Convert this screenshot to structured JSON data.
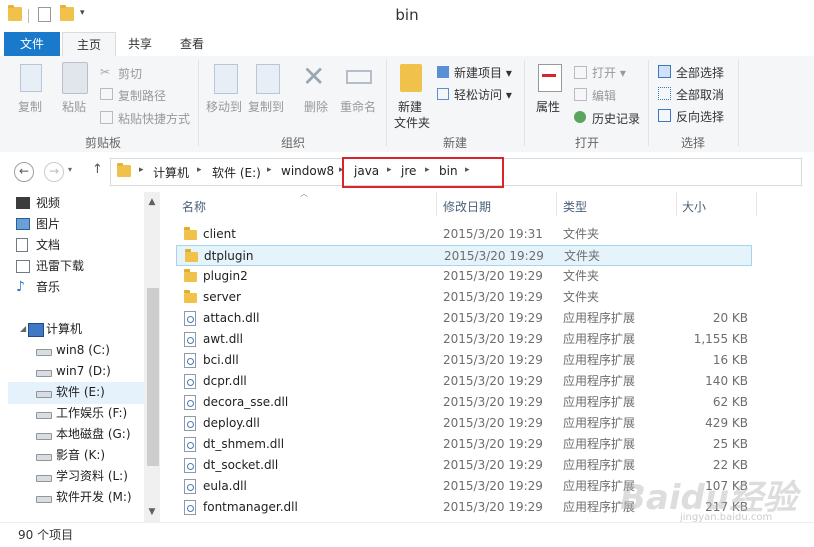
{
  "window": {
    "title": "bin"
  },
  "ribbon_tabs": [
    "文件",
    "主页",
    "共享",
    "查看"
  ],
  "ribbon": {
    "clipboard": {
      "group": "剪贴板",
      "copy": "复制",
      "paste": "粘贴",
      "cut": "剪切",
      "copy_path": "复制路径",
      "paste_shortcut": "粘贴快捷方式"
    },
    "organize": {
      "group": "组织",
      "move_to": "移动到",
      "copy_to": "复制到",
      "delete": "删除",
      "rename": "重命名"
    },
    "new": {
      "group": "新建",
      "new_folder_line1": "新建",
      "new_folder_line2": "文件夹",
      "new_item": "新建项目 ▾",
      "easy_access": "轻松访问 ▾"
    },
    "open": {
      "group": "打开",
      "properties": "属性",
      "open": "打开 ▾",
      "edit": "编辑",
      "history": "历史记录"
    },
    "select": {
      "group": "选择",
      "select_all": "全部选择",
      "select_none": "全部取消",
      "invert": "反向选择"
    }
  },
  "nav": {
    "back": "←",
    "forward": "→",
    "up": "↑"
  },
  "breadcrumb": [
    "计算机",
    "软件 (E:)",
    "window8",
    "java",
    "jre",
    "bin"
  ],
  "navpane": {
    "libraries": [
      "视频",
      "图片",
      "文档",
      "迅雷下载",
      "音乐"
    ],
    "computer": "计算机",
    "drives": [
      "win8 (C:)",
      "win7 (D:)",
      "软件 (E:)",
      "工作娱乐 (F:)",
      "本地磁盘 (G:)",
      "影音 (K:)",
      "学习资料 (L:)",
      "软件开发 (M:)"
    ],
    "selected": "软件 (E:)"
  },
  "columns": {
    "name": "名称",
    "date": "修改日期",
    "type": "类型",
    "size": "大小"
  },
  "files": [
    {
      "name": "client",
      "date": "2015/3/20 19:31",
      "type": "文件夹",
      "size": "",
      "kind": "folder"
    },
    {
      "name": "dtplugin",
      "date": "2015/3/20 19:29",
      "type": "文件夹",
      "size": "",
      "kind": "folder"
    },
    {
      "name": "plugin2",
      "date": "2015/3/20 19:29",
      "type": "文件夹",
      "size": "",
      "kind": "folder"
    },
    {
      "name": "server",
      "date": "2015/3/20 19:29",
      "type": "文件夹",
      "size": "",
      "kind": "folder"
    },
    {
      "name": "attach.dll",
      "date": "2015/3/20 19:29",
      "type": "应用程序扩展",
      "size": "20 KB",
      "kind": "dll"
    },
    {
      "name": "awt.dll",
      "date": "2015/3/20 19:29",
      "type": "应用程序扩展",
      "size": "1,155 KB",
      "kind": "dll"
    },
    {
      "name": "bci.dll",
      "date": "2015/3/20 19:29",
      "type": "应用程序扩展",
      "size": "16 KB",
      "kind": "dll"
    },
    {
      "name": "dcpr.dll",
      "date": "2015/3/20 19:29",
      "type": "应用程序扩展",
      "size": "140 KB",
      "kind": "dll"
    },
    {
      "name": "decora_sse.dll",
      "date": "2015/3/20 19:29",
      "type": "应用程序扩展",
      "size": "62 KB",
      "kind": "dll"
    },
    {
      "name": "deploy.dll",
      "date": "2015/3/20 19:29",
      "type": "应用程序扩展",
      "size": "429 KB",
      "kind": "dll"
    },
    {
      "name": "dt_shmem.dll",
      "date": "2015/3/20 19:29",
      "type": "应用程序扩展",
      "size": "25 KB",
      "kind": "dll"
    },
    {
      "name": "dt_socket.dll",
      "date": "2015/3/20 19:29",
      "type": "应用程序扩展",
      "size": "22 KB",
      "kind": "dll"
    },
    {
      "name": "eula.dll",
      "date": "2015/3/20 19:29",
      "type": "应用程序扩展",
      "size": "107 KB",
      "kind": "dll"
    },
    {
      "name": "fontmanager.dll",
      "date": "2015/3/20 19:29",
      "type": "应用程序扩展",
      "size": "217 KB",
      "kind": "dll"
    }
  ],
  "selected_file": "dtplugin",
  "status": {
    "count": "90 个项目"
  },
  "watermark": {
    "main": "Baidu经验",
    "sub": "jingyan.baidu.com"
  },
  "colors": {
    "accent": "#1979ca",
    "highlight_box": "#d9242b",
    "selection": "#e5f3fb"
  }
}
